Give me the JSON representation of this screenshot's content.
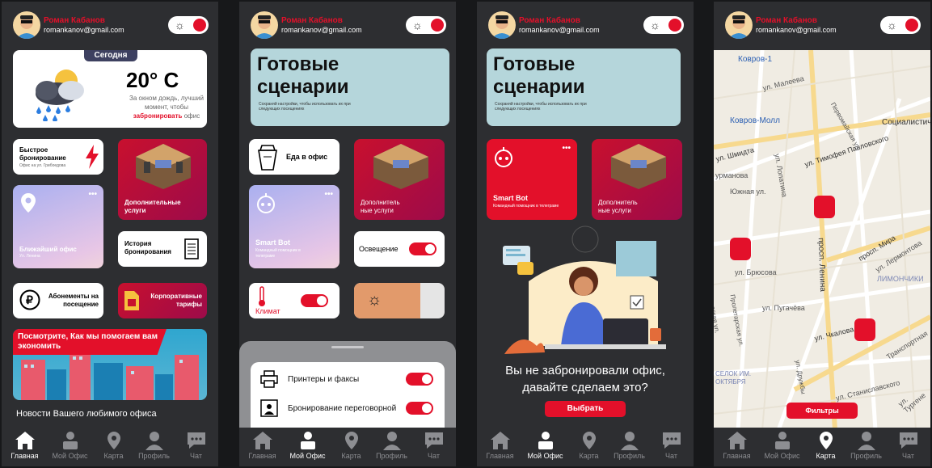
{
  "user": {
    "name": "Роман Кабанов",
    "email": "romankanov@gmail.com"
  },
  "screen1": {
    "weather_badge": "Сегодня",
    "temperature": "20° C",
    "weather_text": "За окном дождь, лучший момент, чтобы",
    "weather_link": "забронировать",
    "weather_tail": "офис",
    "quick_booking": "Быстрое бронирование",
    "quick_booking_sub": "Офис на ул. Грибоедова",
    "extra_services": "Дополнительные услуги",
    "nearest_office": "Ближайший офис",
    "nearest_office_sub": "Ул. Ленина",
    "booking_history": "История бронирования",
    "subscriptions": "Абонементы на посещение",
    "corporate": "Корпоративные тарифы",
    "banner": "Посмотрите, Как мы помогаем вам экономить",
    "news": "Новости Вашего любимого офиса"
  },
  "screen2": {
    "title": "Готовые сценарии",
    "subtitle": "Сохраняй настройки, чтобы использовать их при следующих посещениях",
    "food": "Еда в офис",
    "extra": "Дополнитель ные услуги",
    "bot": "Smart Bot",
    "bot_sub": "Командный помощник в телеграме",
    "lighting": "Освещение",
    "climate": "Климат",
    "printers": "Принтеры и факсы",
    "meeting": "Бронирование переговорной"
  },
  "screen3": {
    "title": "Готовые сценарии",
    "subtitle": "Сохраняй настройки, чтобы использовать их при следующих посещениях",
    "bot": "Smart Bot",
    "bot_sub": "Командный помощник в телеграме",
    "extra": "Дополнитель ные услуги",
    "empty_text": "Вы не забронировали офис, давайте сделаем это?",
    "choose": "Выбрать"
  },
  "map": {
    "filters": "Фильтры",
    "labels": [
      "Ковров-1",
      "ул. Малеева",
      "Ковров-Молл",
      "Социалистиче",
      "ул. Шмидта",
      "урманова",
      "Южная ул.",
      "ул. Тимофея Павловского",
      "Первомайская ул.",
      "ул. Лопатина",
      "просп. Мира",
      "ул. Лермонтова",
      "ЛИМОНЧИКИ",
      "ул. Брюсова",
      "просп. Ленина",
      "ул. Пугачёва",
      "Пролетарская ул.",
      "Заводская ул.",
      "ул. Чкалова",
      "Транспортная",
      "СЕЛОК ИМ. ОКТЯБРЯ",
      "ул. Дружбы",
      "ул. Станиславского",
      "ул. Тургене"
    ]
  },
  "nav": {
    "home": "Главная",
    "office": "Мой Офис",
    "map": "Карта",
    "profile": "Профиль",
    "chat": "Чат"
  },
  "colors": {
    "accent": "#e3102a",
    "bg": "#2d2e31",
    "scenario": "#b5d6db"
  }
}
